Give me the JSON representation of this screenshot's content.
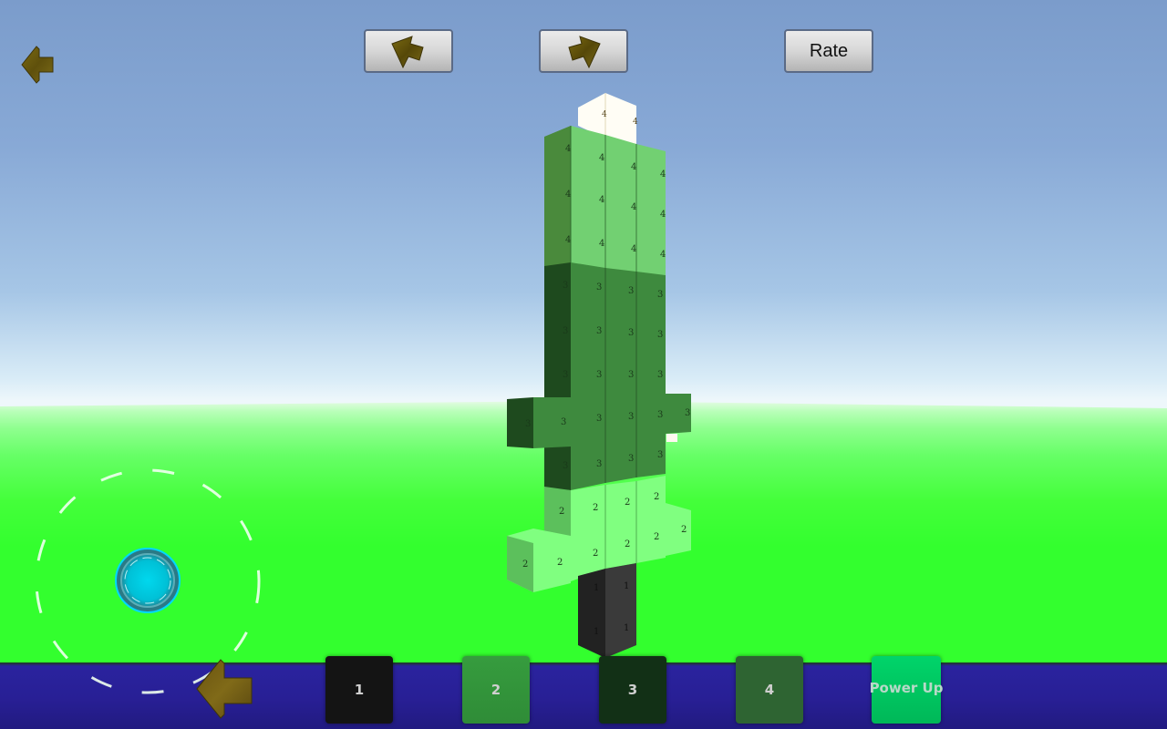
{
  "toolbar": {
    "back_icon": "back-arrow-icon",
    "undo_icon": "undo-arrow-icon",
    "redo_icon": "redo-arrow-icon",
    "rate_label": "Rate"
  },
  "model": {
    "name": "voxel-sword",
    "sections": [
      {
        "label": "4",
        "role": "blade-tip",
        "color": "#6fd06f"
      },
      {
        "label": "3",
        "role": "blade-base-and-guard",
        "color": "#3e8a3e"
      },
      {
        "label": "2",
        "role": "crossguard",
        "color": "#80ff80"
      },
      {
        "label": "1",
        "role": "handle",
        "color": "#2a2a2a"
      }
    ],
    "tip_color": "#ffffff"
  },
  "controls": {
    "joystick_icon": "joystick-icon",
    "bottom_back_icon": "back-arrow-icon"
  },
  "palette": {
    "colors": [
      {
        "label": "1",
        "color": "#141414"
      },
      {
        "label": "2",
        "color": "#359a3d"
      },
      {
        "label": "3",
        "color": "#123016"
      },
      {
        "label": "4",
        "color": "#2e6432"
      }
    ],
    "powerup_label": "Power Up",
    "powerup_color": "#00c862"
  },
  "colors": {
    "sky": "#88a9d6",
    "ground": "#33ff2e",
    "bottom_bar": "#281f95",
    "arrow": "#6b5a10"
  }
}
